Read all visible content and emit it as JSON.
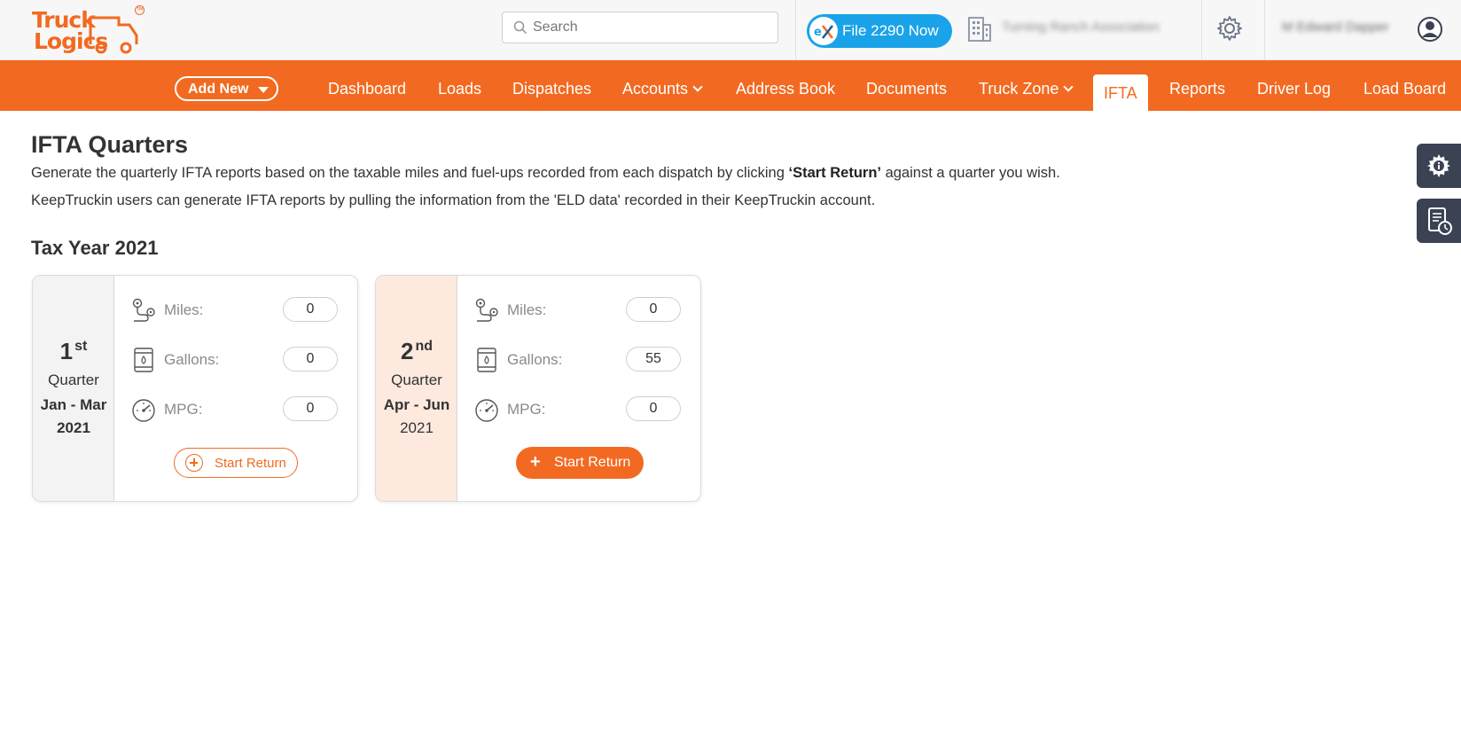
{
  "brand": {
    "line1": "Truck",
    "line2": "Logics",
    "tm": "TM",
    "color": "#f26a21"
  },
  "header": {
    "search_placeholder": "Search",
    "file_button_label": "File 2290 Now",
    "company_name": "Turning Ranch Association",
    "user_name": "M Edward Dapper"
  },
  "nav": {
    "add_new_label": "Add New",
    "items": [
      {
        "label": "Dashboard"
      },
      {
        "label": "Loads"
      },
      {
        "label": "Dispatches"
      },
      {
        "label": "Accounts"
      },
      {
        "label": "Address Book"
      },
      {
        "label": "Documents"
      },
      {
        "label": "Truck Zone"
      },
      {
        "label": "IFTA"
      },
      {
        "label": "Reports"
      },
      {
        "label": "Driver Log"
      },
      {
        "label": "Load Board"
      }
    ],
    "active": "IFTA"
  },
  "page": {
    "title": "IFTA Quarters",
    "desc1_pre": "Generate the quarterly IFTA reports based on the taxable miles and fuel-ups recorded from each dispatch by clicking ",
    "desc1_bold": "‘Start Return’",
    "desc1_post": " against a quarter you wish.",
    "desc2": "KeepTruckin users can generate IFTA reports by pulling the information from the 'ELD data' recorded in their KeepTruckin account.",
    "tax_year": "Tax Year 2021"
  },
  "quarters": [
    {
      "number": "1",
      "suffix": "st",
      "label": "Quarter",
      "months": "Jan - Mar",
      "year": "2021",
      "miles_label": "Miles:",
      "miles": "0",
      "gallons_label": "Gallons:",
      "gallons": "0",
      "mpg_label": "MPG:",
      "mpg": "0",
      "button_label": "Start Return"
    },
    {
      "number": "2",
      "suffix": "nd",
      "label": "Quarter",
      "months": "Apr - Jun",
      "year": "2021",
      "miles_label": "Miles:",
      "miles": "0",
      "gallons_label": "Gallons:",
      "gallons": "55",
      "mpg_label": "MPG:",
      "mpg": "0",
      "button_label": "Start Return"
    }
  ]
}
